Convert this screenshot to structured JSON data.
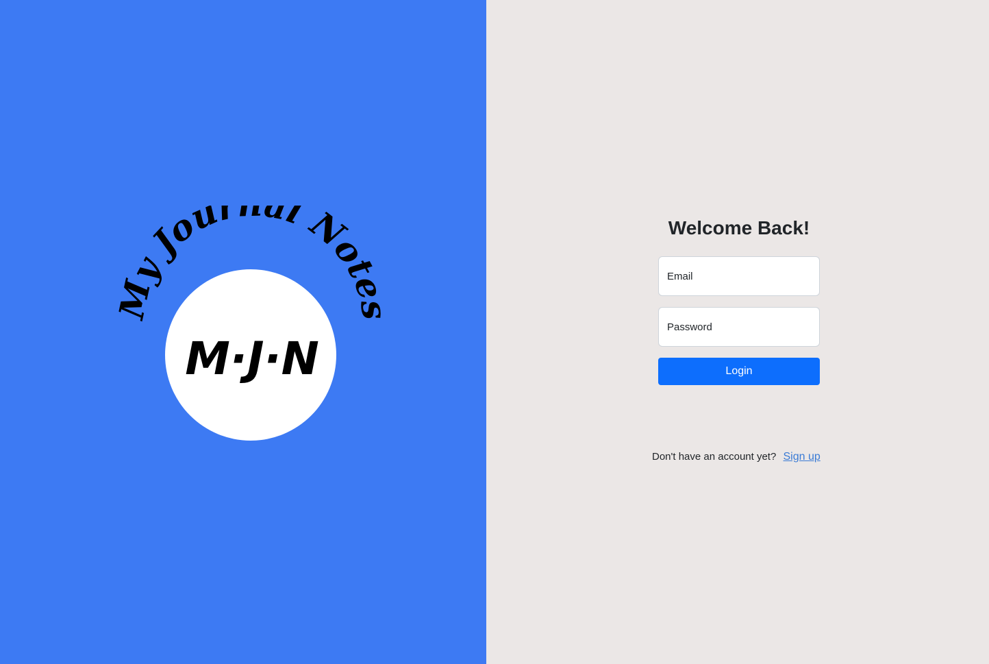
{
  "logo": {
    "arc_text": "My Journal Notes",
    "monogram": "M·J·N"
  },
  "login": {
    "title": "Welcome Back!",
    "email_placeholder": "Email",
    "password_placeholder": "Password",
    "login_label": "Login"
  },
  "signup": {
    "prompt": "Don't have an account yet?",
    "link_label": "Sign up"
  },
  "colors": {
    "left_background": "#3d7af3",
    "right_background": "#ebe7e6",
    "button": "#0d6efd",
    "link": "#3a7bd5"
  }
}
